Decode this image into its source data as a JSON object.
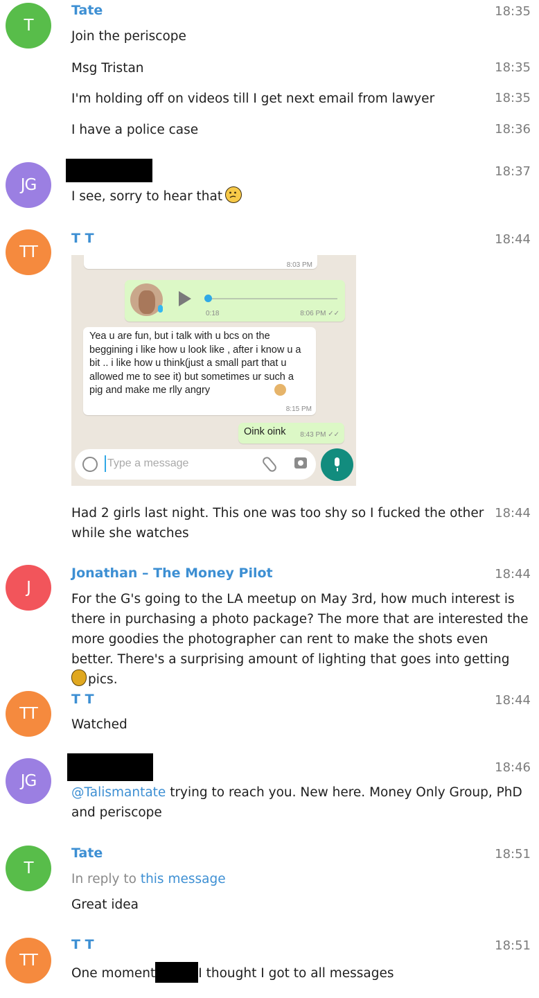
{
  "messages": [
    {
      "sender": "Tate",
      "avatar": "T",
      "avatar_color": "#58bd4a",
      "lines": [
        {
          "text": "Join the periscope",
          "time": "18:35"
        },
        {
          "text": "Msg Tristan",
          "time": "18:35"
        },
        {
          "text": "I'm holding off on videos till I get next email from lawyer",
          "time": "18:35"
        },
        {
          "text": "I have a police case",
          "time": "18:36"
        }
      ]
    },
    {
      "sender": "",
      "avatar": "JG",
      "avatar_color": "#9b7fe2",
      "time": "18:37",
      "text": "I see, sorry to hear that"
    },
    {
      "sender": "T T",
      "avatar": "TT",
      "avatar_color": "#f58a3e",
      "time": "18:44",
      "embedded_chat": {
        "time_top": "8:03 PM",
        "voice_duration": "0:18",
        "voice_time": "8:06 PM ✓✓",
        "incoming_text": "Yea u are fun, but i talk with u bcs on the beggining i like how u look like , after i know u a bit .. i like how u think(just a small part that u allowed me to see it) but sometimes ur such a pig and make me rlly angry",
        "incoming_time": "8:15 PM",
        "outgoing_text": "Oink oink",
        "outgoing_time": "8:43 PM ✓✓",
        "input_placeholder": "Type a message"
      },
      "followup": {
        "text": "Had 2 girls last night. This one was too shy so I fucked the other while she watches",
        "time": "18:44"
      }
    },
    {
      "sender": "Jonathan – The Money Pilot",
      "avatar": "J",
      "avatar_color": "#f2555b",
      "time": "18:44",
      "text_before_emoji": "For the G's going to the LA meetup on May 3rd, how much interest is there in purchasing a photo package? The more that are interested the more goodies the photographer can rent to make the shots even better. There's a surprising amount of lighting that goes into getting",
      "text_after_emoji": "pics."
    },
    {
      "sender": "T T",
      "avatar": "TT",
      "avatar_color": "#f58a3e",
      "time": "18:44",
      "text": "Watched"
    },
    {
      "sender": "",
      "avatar": "JG",
      "avatar_color": "#9b7fe2",
      "time": "18:46",
      "mention": "@Talismantate",
      "text": " trying to reach you. New here. Money Only Group, PhD and periscope"
    },
    {
      "sender": "Tate",
      "avatar": "T",
      "avatar_color": "#58bd4a",
      "time": "18:51",
      "reply_prefix": "In reply to ",
      "reply_link": "this message",
      "text": "Great idea"
    },
    {
      "sender": "T T",
      "avatar": "TT",
      "avatar_color": "#f58a3e",
      "time": "18:51",
      "text_before": "One moment",
      "text_after": "I thought I got to all messages"
    }
  ]
}
